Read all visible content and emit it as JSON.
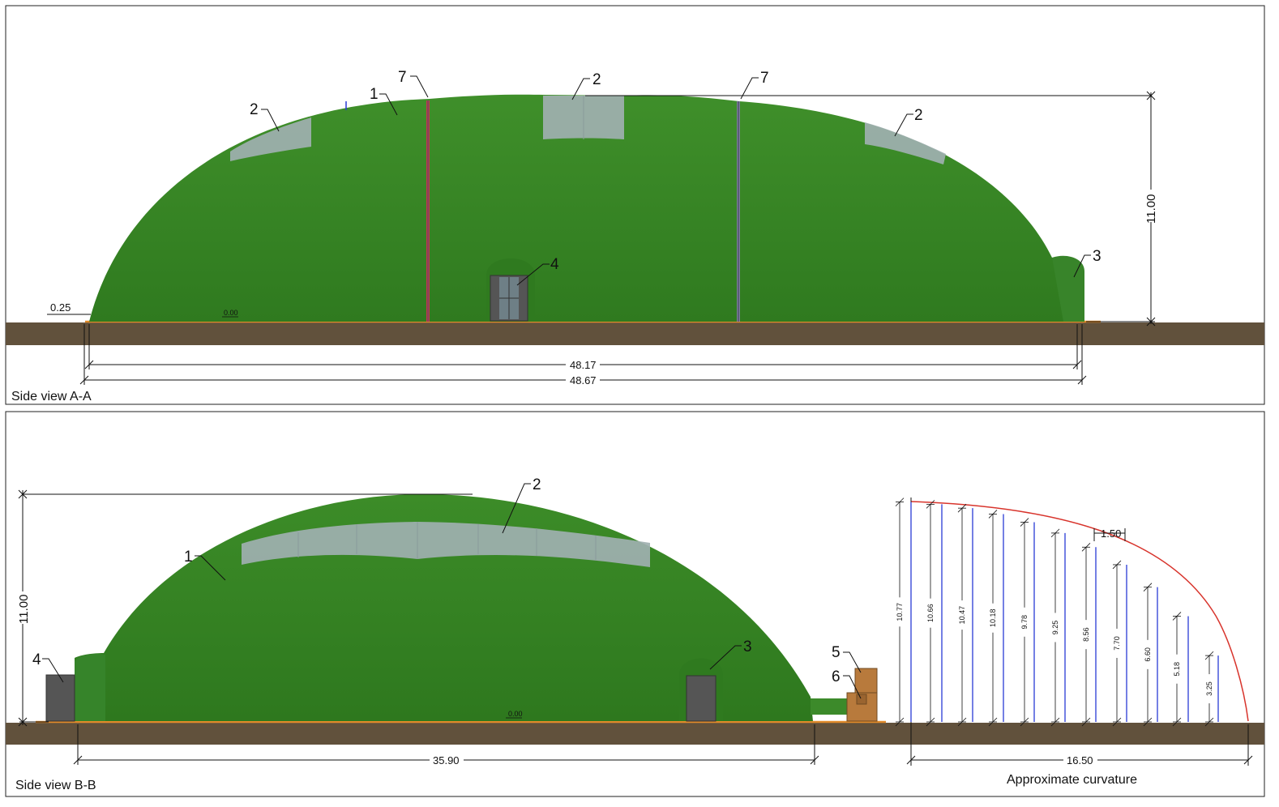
{
  "view_a": {
    "caption": "Side view A-A",
    "callouts": {
      "c1": "1",
      "c2a": "2",
      "c2b": "2",
      "c2c": "2",
      "c3": "3",
      "c4": "4",
      "c7a": "7",
      "c7b": "7"
    },
    "dims": {
      "height": "11.00",
      "offset": "0.25",
      "width_inner": "48.17",
      "width_outer": "48.67",
      "level": "0.00"
    }
  },
  "view_b": {
    "caption": "Side view  B-B",
    "callouts": {
      "c1": "1",
      "c2": "2",
      "c3": "3",
      "c4": "4",
      "c5": "5",
      "c6": "6"
    },
    "dims": {
      "height": "11.00",
      "width": "35.90",
      "level": "0.00"
    }
  },
  "curvature": {
    "caption": "Approximate curvature",
    "span": "16.50",
    "spacing": "1.50",
    "heights": [
      "10.77",
      "10.66",
      "10.47",
      "10.18",
      "9.78",
      "9.25",
      "8.56",
      "7.70",
      "6.60",
      "5.18",
      "3.25"
    ]
  },
  "colors": {
    "membrane": "#3a8a28",
    "ground": "#61513c",
    "window": "#9fb0b0",
    "curve": "#d8342c",
    "ordinate": "#2a3bd6",
    "box": "#b87a3c"
  }
}
